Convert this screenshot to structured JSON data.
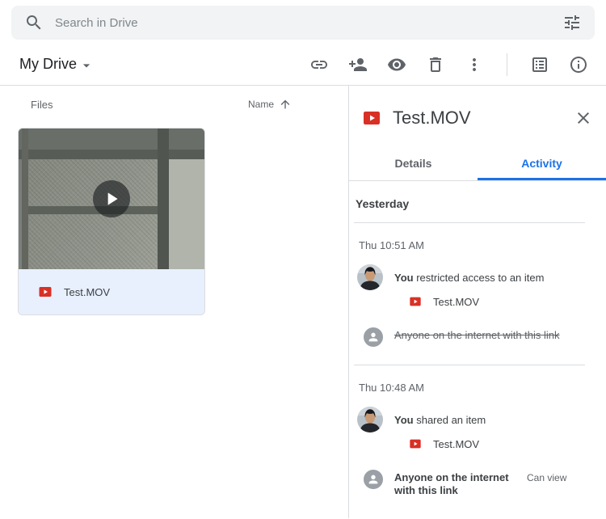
{
  "colors": {
    "accent_blue": "#1a73e8",
    "video_red": "#d93025",
    "selected_row_bg": "#e8f0fe",
    "divider": "#dadce0",
    "secondary_text": "#5f6368"
  },
  "icons": {
    "search": "magnifier",
    "search_options": "tune-sliders",
    "chevron_down": "dropdown-triangle",
    "get_link": "chain-link",
    "share": "person-add",
    "preview": "eye",
    "delete": "trash-can",
    "more": "three-vertical-dots",
    "list_view": "box-with-lines",
    "info": "circled-i",
    "sort_ascending": "arrow-up",
    "play": "play-triangle",
    "close": "x",
    "video_file": "red-rectangle-play",
    "anyone": "person-silhouette"
  },
  "search": {
    "placeholder": "Search in Drive"
  },
  "toolbar": {
    "location": "My Drive"
  },
  "files": {
    "header": "Files",
    "sort_label": "Name",
    "items": [
      {
        "name": "Test.MOV",
        "type": "video",
        "selected": true
      }
    ]
  },
  "panel": {
    "title": "Test.MOV",
    "tabs": {
      "details": "Details",
      "activity": "Activity"
    },
    "activity": {
      "day_label": "Yesterday",
      "events": [
        {
          "time": "Thu 10:51 AM",
          "actor": "You",
          "action": "restricted access to an item",
          "file": "Test.MOV",
          "audience": "Anyone on the internet with this link",
          "audience_removed": true
        },
        {
          "time": "Thu 10:48 AM",
          "actor": "You",
          "action": "shared an item",
          "file": "Test.MOV",
          "audience": "Anyone on the internet with this link",
          "permission": "Can view"
        }
      ]
    }
  }
}
